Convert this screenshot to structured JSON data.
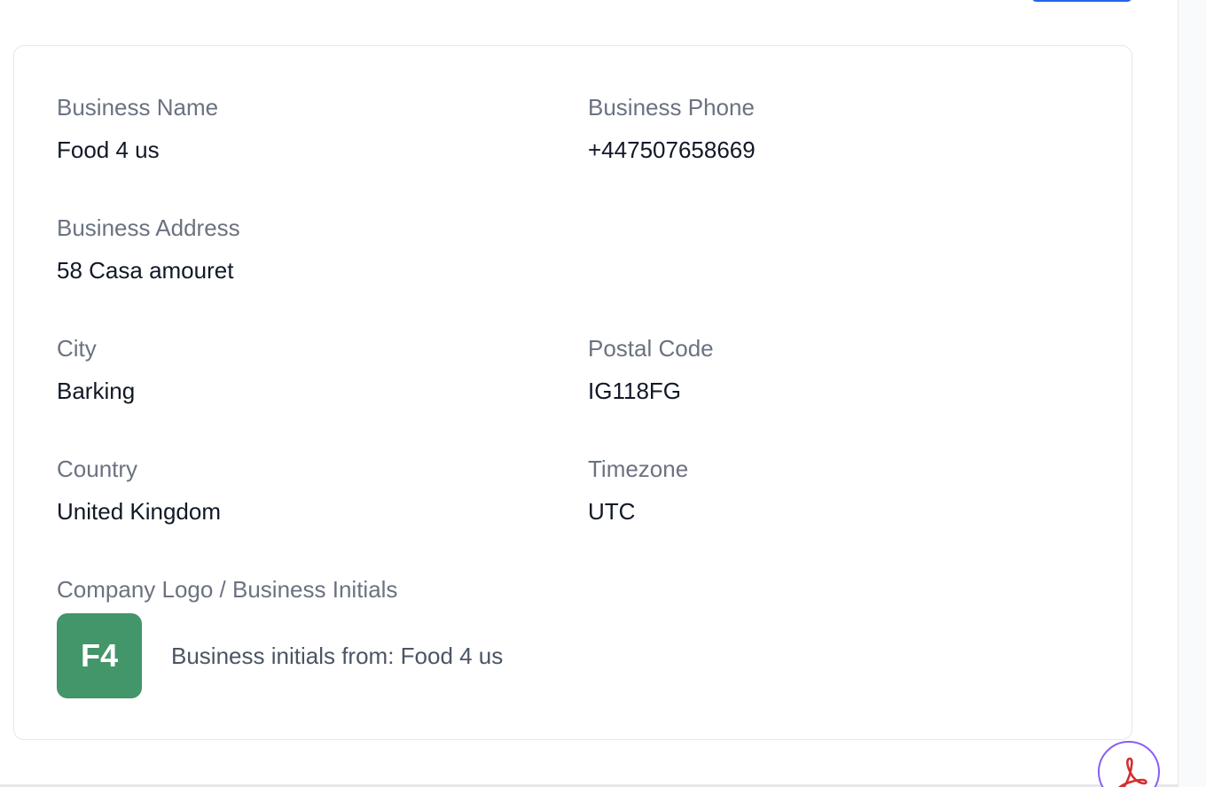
{
  "business": {
    "name_label": "Business Name",
    "name_value": "Food 4 us",
    "phone_label": "Business Phone",
    "phone_value": "+447507658669",
    "address_label": "Business Address",
    "address_value": "58 Casa amouret",
    "city_label": "City",
    "city_value": "Barking",
    "postal_label": "Postal Code",
    "postal_value": "IG118FG",
    "country_label": "Country",
    "country_value": "United Kingdom",
    "timezone_label": "Timezone",
    "timezone_value": "UTC",
    "logo_label": "Company Logo / Business Initials",
    "initials": "F4",
    "initials_caption": "Business initials from: Food 4 us"
  },
  "colors": {
    "initials_bg": "#43956a",
    "label": "#6b7280",
    "value": "#111827",
    "primary_button": "#2563eb",
    "fab_border": "#8b5cf6",
    "pdf_icon": "#d32f2f"
  },
  "icons": {
    "fab": "pdf-icon"
  }
}
